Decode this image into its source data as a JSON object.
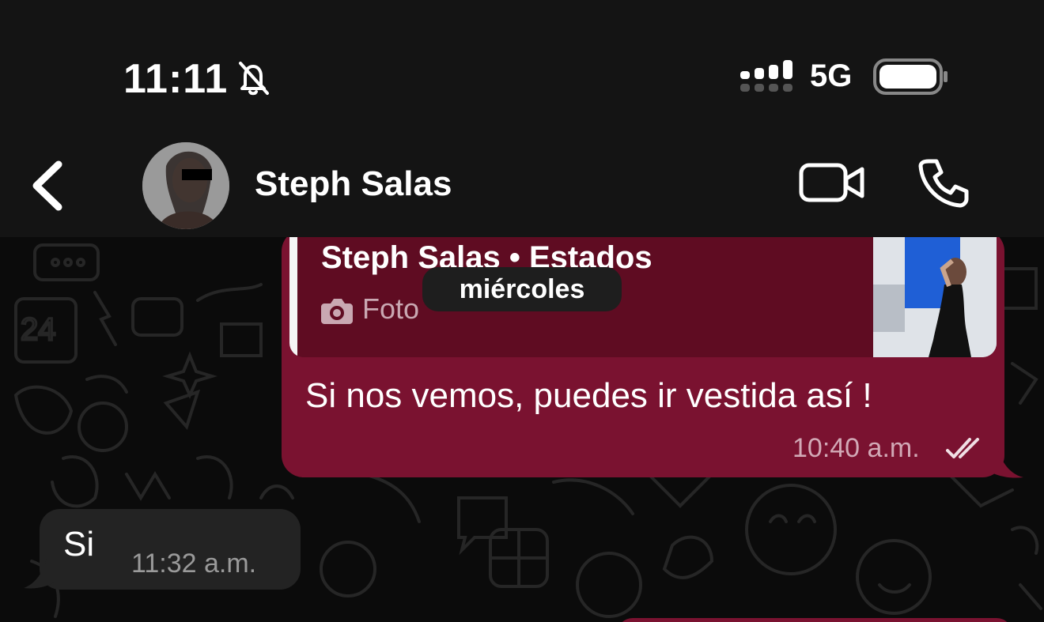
{
  "status_bar": {
    "time": "11:11",
    "network": "5G",
    "icons": [
      "bell-slash-icon",
      "signal-icon",
      "battery-icon"
    ]
  },
  "header": {
    "contact_name": "Steph Salas",
    "icons": [
      "chevron-left-icon",
      "video-call-icon",
      "phone-icon"
    ]
  },
  "chat": {
    "day_separator": "miércoles",
    "messages": [
      {
        "direction": "outgoing",
        "quoted": {
          "title": "Steph Salas • Estados",
          "subtitle": "Foto",
          "icon": "camera-icon"
        },
        "text": "Si nos vemos, puedes ir vestida así !",
        "time": "10:40 a.m.",
        "status_icon": "double-check-icon"
      },
      {
        "direction": "incoming",
        "text": "Si",
        "time": "11:32 a.m."
      }
    ]
  },
  "colors": {
    "outgoing_bubble": "#7a1230",
    "quote_bg": "#5f0c22",
    "incoming_bubble": "#232323",
    "header_bg": "#141414",
    "chat_bg": "#0b0b0b"
  }
}
